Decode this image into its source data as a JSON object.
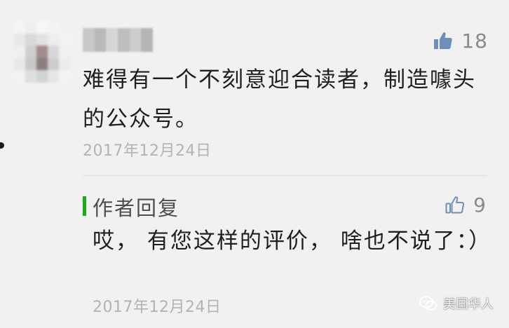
{
  "comment": {
    "likes": "18",
    "text": "难得有一个不刻意迎合读者，制造噱头的公众号。",
    "date": "2017年12月24日"
  },
  "reply": {
    "title": "作者回复",
    "likes": "9",
    "text": "哎， 有您这样的评价， 啥也不说了：）",
    "date": "2017年12月24日"
  },
  "watermark": {
    "label": "美国华人",
    "icon": "wechat-icon"
  },
  "colors": {
    "background": "#f1f1f1",
    "reply_accent": "#1aad19",
    "like_filled": "#6e8fb8",
    "like_outline": "#6e8fb8",
    "date_text": "#b3b3b3"
  }
}
